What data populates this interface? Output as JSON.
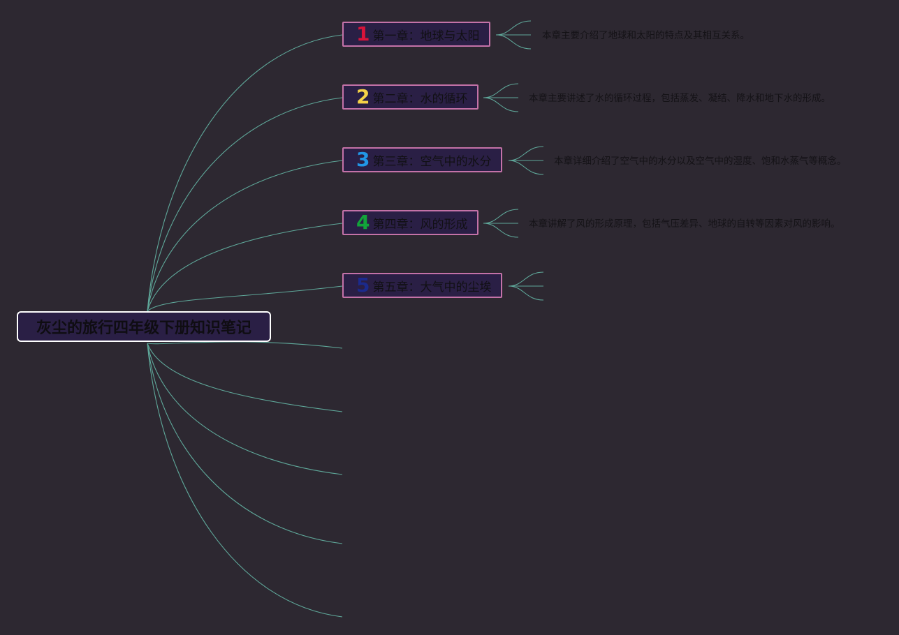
{
  "root": {
    "title": "灰尘的旅行四年级下册知识笔记"
  },
  "chapters": [
    {
      "number": "1",
      "number_color": "#d8143a",
      "title": "第一章：地球与太阳",
      "summary": "本章主要介绍了地球和太阳的特点及其相互关系。"
    },
    {
      "number": "2",
      "number_color": "#f5d247",
      "title": "第二章：水的循环",
      "summary": "本章主要讲述了水的循环过程，包括蒸发、凝结、降水和地下水的形成。"
    },
    {
      "number": "3",
      "number_color": "#2196e6",
      "title": "第三章：空气中的水分",
      "summary": "本章详细介绍了空气中的水分以及空气中的湿度、饱和水蒸气等概念。"
    },
    {
      "number": "4",
      "number_color": "#12a43a",
      "title": "第四章：风的形成",
      "summary": "本章讲解了风的形成原理，包括气压差异、地球的自转等因素对风的影响。"
    },
    {
      "number": "5",
      "number_color": "#1b2a8c",
      "title": "第五章：大气中的尘埃",
      "summary": ""
    }
  ],
  "colors": {
    "background": "#2d2831",
    "link": "#5fa89a",
    "node_fill": "#2a1f45",
    "chapter_border": "#c472a8",
    "root_border": "#ffffff"
  }
}
